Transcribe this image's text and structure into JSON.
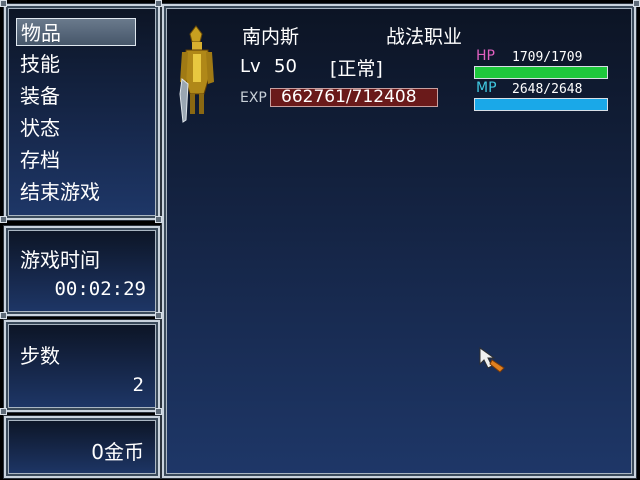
{
  "menu": {
    "items": [
      {
        "label": "物品",
        "selected": true
      },
      {
        "label": "技能",
        "selected": false
      },
      {
        "label": "装备",
        "selected": false
      },
      {
        "label": "状态",
        "selected": false
      },
      {
        "label": "存档",
        "selected": false
      },
      {
        "label": "结束游戏",
        "selected": false
      }
    ]
  },
  "playtime": {
    "label": "游戏时间",
    "value": "00:02:29"
  },
  "steps": {
    "label": "步数",
    "value": "2"
  },
  "gold": {
    "value": "0金币"
  },
  "character": {
    "name": "南内斯",
    "class": "战法职业",
    "level_label": "Lv",
    "level": "50",
    "status": "[正常]",
    "exp_label": "EXP",
    "exp": "662761/712408",
    "hp_label": "HP",
    "hp": "1709/1709",
    "hp_fraction": 1.0,
    "mp_label": "MP",
    "mp": "2648/2648",
    "mp_fraction": 1.0
  },
  "colors": {
    "hp_bar": "#1ec83c",
    "mp_bar": "#1aa8e8",
    "hp_label": "#e060c0",
    "mp_label": "#40c8e0",
    "exp_box": "#6a1a1a"
  },
  "cursor": {
    "icon": "hand-pointer-icon"
  }
}
